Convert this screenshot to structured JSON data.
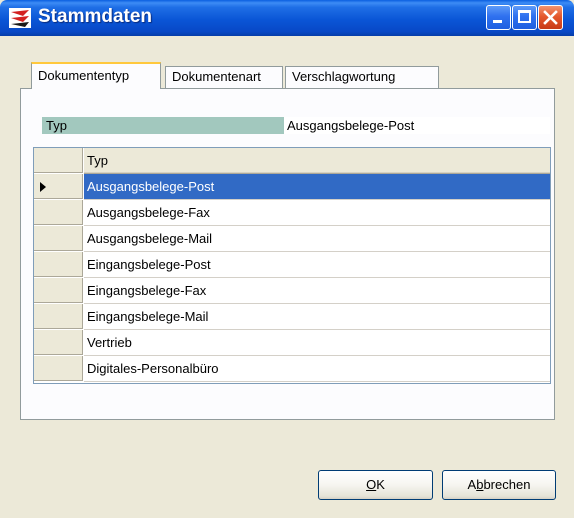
{
  "window": {
    "title": "Stammdaten",
    "icon": "app-logo-icon"
  },
  "tabs": [
    {
      "label": "Dokumententyp",
      "active": true
    },
    {
      "label": "Dokumentenart",
      "active": false
    },
    {
      "label": "Verschlagwortung",
      "active": false
    }
  ],
  "field": {
    "label": "Typ",
    "value": "Ausgangsbelege-Post"
  },
  "grid": {
    "column_header": "Typ",
    "rows": [
      "Ausgangsbelege-Post",
      "Ausgangsbelege-Fax",
      "Ausgangsbelege-Mail",
      "Eingangsbelege-Post",
      "Eingangsbelege-Fax",
      "Eingangsbelege-Mail",
      "Vertrieb",
      "Digitales-Personalbüro"
    ],
    "selected_index": 0
  },
  "buttons": {
    "ok_mnemonic": "O",
    "ok_rest": "K",
    "cancel_pre": "A",
    "cancel_mnemonic": "b",
    "cancel_rest": "brechen"
  },
  "colors": {
    "selection": "#316ac5",
    "field_label_bg": "#a2c8be",
    "titlebar": "#0a55d6"
  }
}
